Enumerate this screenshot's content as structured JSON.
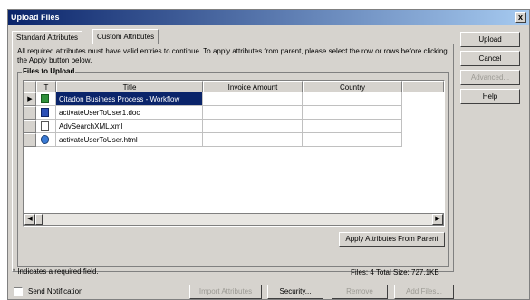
{
  "window": {
    "title": "Upload Files",
    "close_label": "x"
  },
  "tabs": [
    {
      "label": "Standard Attributes",
      "active": false
    },
    {
      "label": "Custom Attributes",
      "active": true
    }
  ],
  "info_text": "All required attributes must have valid entries to continue. To apply attributes from parent, please select the row or rows before clicking the Apply button below.",
  "files_group": {
    "label": "Files to Upload",
    "columns": [
      "T",
      "Title",
      "Invoice Amount",
      "Country"
    ],
    "rows": [
      {
        "type_icon": "workflow-icon",
        "title": "Citadon Business Process - Workflow",
        "invoice_amount": "",
        "country": "",
        "selected": true
      },
      {
        "type_icon": "word-document-icon",
        "title": "activateUserToUser1.doc",
        "invoice_amount": "",
        "country": "",
        "selected": false
      },
      {
        "type_icon": "xml-file-icon",
        "title": "AdvSearchXML.xml",
        "invoice_amount": "",
        "country": "",
        "selected": false
      },
      {
        "type_icon": "html-file-icon",
        "title": "activateUserToUser.html",
        "invoice_amount": "",
        "country": "",
        "selected": false
      }
    ],
    "apply_button": "Apply Attributes From Parent"
  },
  "side_buttons": [
    {
      "label": "Upload",
      "enabled": true
    },
    {
      "label": "Cancel",
      "enabled": true
    },
    {
      "label": "Advanced...",
      "enabled": false
    },
    {
      "label": "Help",
      "enabled": true
    }
  ],
  "footer": {
    "required_note": "* Indicates a required field.",
    "summary": "Files: 4 Total Size: 727.1KB",
    "send_notification": "Send Notification",
    "buttons": [
      {
        "label": "Import Attributes",
        "enabled": false
      },
      {
        "label": "Security...",
        "enabled": true
      },
      {
        "label": "Remove",
        "enabled": false
      },
      {
        "label": "Add Files...",
        "enabled": false
      }
    ]
  },
  "colors": {
    "title_bar": "#0a246a",
    "selection": "#0a246a",
    "dialog_bg": "#d6d3ce"
  }
}
